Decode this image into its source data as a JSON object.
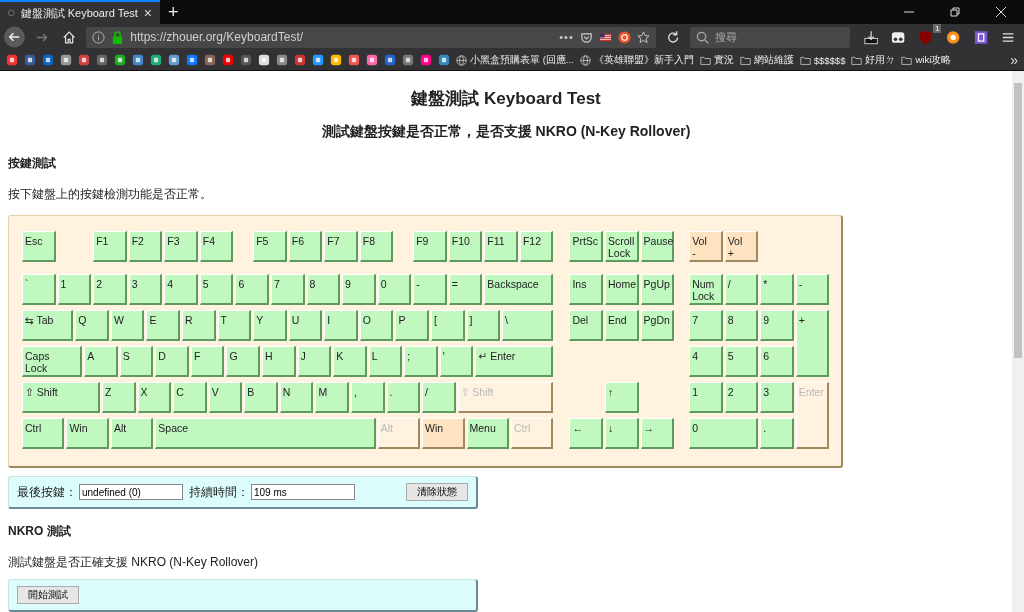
{
  "browser": {
    "tab": {
      "title": "鍵盤測試 Keyboard Test",
      "close": "×"
    },
    "new_tab": "+",
    "url": "https://zhouer.org/KeyboardTest/",
    "page_actions": "•••",
    "search": {
      "placeholder": "搜尋"
    },
    "extension_badge": "1",
    "bookmarks": [
      {
        "kind": "site",
        "label": "小黑盒預購表單 (回應..."
      },
      {
        "kind": "site",
        "label": "《英雄聯盟》新手入門"
      },
      {
        "kind": "folder",
        "label": "實況"
      },
      {
        "kind": "folder",
        "label": "網站維護"
      },
      {
        "kind": "folder",
        "label": "$$$$$$"
      },
      {
        "kind": "folder",
        "label": "好用ㄉ"
      },
      {
        "kind": "folder",
        "label": "wiki攻略"
      }
    ],
    "overflow": "»"
  },
  "page": {
    "title": "鍵盤測試 Keyboard Test",
    "subtitle": "測試鍵盤按鍵是否正常，是否支援 NKRO (N-Key Rollover)",
    "key_test": {
      "heading": "按鍵測試",
      "description": "按下鍵盤上的按鍵檢測功能是否正常。",
      "keyboard": {
        "main_rows": [
          [
            {
              "label": "Esc",
              "tested": true,
              "pressed": false
            },
            {
              "label": "F1",
              "tested": true,
              "pressed": false
            },
            {
              "label": "F2",
              "tested": true,
              "pressed": false
            },
            {
              "label": "F3",
              "tested": true,
              "pressed": false
            },
            {
              "label": "F4",
              "tested": true,
              "pressed": false
            },
            {
              "label": "F5",
              "tested": true,
              "pressed": false
            },
            {
              "label": "F6",
              "tested": true,
              "pressed": false
            },
            {
              "label": "F7",
              "tested": true,
              "pressed": false
            },
            {
              "label": "F8",
              "tested": true,
              "pressed": false
            },
            {
              "label": "F9",
              "tested": true,
              "pressed": false
            },
            {
              "label": "F10",
              "tested": true,
              "pressed": false
            },
            {
              "label": "F11",
              "tested": true,
              "pressed": false
            },
            {
              "label": "F12",
              "tested": true,
              "pressed": false
            }
          ],
          [
            {
              "label": "`",
              "tested": true,
              "pressed": false
            },
            {
              "label": "1",
              "tested": true,
              "pressed": false
            },
            {
              "label": "2",
              "tested": true,
              "pressed": false
            },
            {
              "label": "3",
              "tested": true,
              "pressed": false
            },
            {
              "label": "4",
              "tested": true,
              "pressed": false
            },
            {
              "label": "5",
              "tested": true,
              "pressed": false
            },
            {
              "label": "6",
              "tested": true,
              "pressed": false
            },
            {
              "label": "7",
              "tested": true,
              "pressed": false
            },
            {
              "label": "8",
              "tested": true,
              "pressed": false
            },
            {
              "label": "9",
              "tested": true,
              "pressed": false
            },
            {
              "label": "0",
              "tested": true,
              "pressed": false
            },
            {
              "label": "-",
              "tested": true,
              "pressed": false
            },
            {
              "label": "=",
              "tested": true,
              "pressed": false
            },
            {
              "label": "Backspace",
              "tested": true,
              "pressed": false
            }
          ],
          [
            {
              "label": "⇆ Tab",
              "tested": true,
              "pressed": false
            },
            {
              "label": "Q",
              "tested": true,
              "pressed": false
            },
            {
              "label": "W",
              "tested": true,
              "pressed": false
            },
            {
              "label": "E",
              "tested": true,
              "pressed": false
            },
            {
              "label": "R",
              "tested": true,
              "pressed": false
            },
            {
              "label": "T",
              "tested": true,
              "pressed": false
            },
            {
              "label": "Y",
              "tested": true,
              "pressed": false
            },
            {
              "label": "U",
              "tested": true,
              "pressed": false
            },
            {
              "label": "I",
              "tested": true,
              "pressed": false
            },
            {
              "label": "O",
              "tested": true,
              "pressed": false
            },
            {
              "label": "P",
              "tested": true,
              "pressed": false
            },
            {
              "label": "[",
              "tested": true,
              "pressed": false
            },
            {
              "label": "]",
              "tested": true,
              "pressed": false
            },
            {
              "label": "\\",
              "tested": true,
              "pressed": false
            }
          ],
          [
            {
              "label": "Caps\nLock",
              "tested": true,
              "pressed": false
            },
            {
              "label": "A",
              "tested": true,
              "pressed": false
            },
            {
              "label": "S",
              "tested": true,
              "pressed": false
            },
            {
              "label": "D",
              "tested": true,
              "pressed": false
            },
            {
              "label": "F",
              "tested": true,
              "pressed": false
            },
            {
              "label": "G",
              "tested": true,
              "pressed": false
            },
            {
              "label": "H",
              "tested": true,
              "pressed": false
            },
            {
              "label": "J",
              "tested": true,
              "pressed": false
            },
            {
              "label": "K",
              "tested": true,
              "pressed": false
            },
            {
              "label": "L",
              "tested": true,
              "pressed": false
            },
            {
              "label": ";",
              "tested": true,
              "pressed": false
            },
            {
              "label": "'",
              "tested": true,
              "pressed": false
            },
            {
              "label": "↵ Enter",
              "tested": true,
              "pressed": false
            }
          ],
          [
            {
              "label": "⇧ Shift",
              "tested": true,
              "pressed": false
            },
            {
              "label": "Z",
              "tested": true,
              "pressed": false
            },
            {
              "label": "X",
              "tested": true,
              "pressed": false
            },
            {
              "label": "C",
              "tested": true,
              "pressed": false
            },
            {
              "label": "V",
              "tested": true,
              "pressed": false
            },
            {
              "label": "B",
              "tested": true,
              "pressed": false
            },
            {
              "label": "N",
              "tested": true,
              "pressed": false
            },
            {
              "label": "M",
              "tested": true,
              "pressed": false
            },
            {
              "label": ",",
              "tested": true,
              "pressed": false
            },
            {
              "label": ".",
              "tested": true,
              "pressed": false
            },
            {
              "label": "/",
              "tested": true,
              "pressed": false
            },
            {
              "label": "⇧ Shift",
              "tested": false,
              "pressed": false
            }
          ],
          [
            {
              "label": "Ctrl",
              "tested": true,
              "pressed": false
            },
            {
              "label": "Win",
              "tested": true,
              "pressed": false
            },
            {
              "label": "Alt",
              "tested": true,
              "pressed": false
            },
            {
              "label": "Space",
              "tested": true,
              "pressed": false
            },
            {
              "label": "Alt",
              "tested": false,
              "pressed": false
            },
            {
              "label": "Win",
              "tested": false,
              "pressed": true
            },
            {
              "label": "Menu",
              "tested": true,
              "pressed": false
            },
            {
              "label": "Ctrl",
              "tested": false,
              "pressed": false
            }
          ]
        ],
        "nav_keys": [
          {
            "label": "PrtSc",
            "tested": true,
            "pressed": false
          },
          {
            "label": "Scroll\nLock",
            "tested": true,
            "pressed": false
          },
          {
            "label": "Pause",
            "tested": true,
            "pressed": false
          },
          {
            "label": "Ins",
            "tested": true,
            "pressed": false
          },
          {
            "label": "Home",
            "tested": true,
            "pressed": false
          },
          {
            "label": "PgUp",
            "tested": true,
            "pressed": false
          },
          {
            "label": "Del",
            "tested": true,
            "pressed": false
          },
          {
            "label": "End",
            "tested": true,
            "pressed": false
          },
          {
            "label": "PgDn",
            "tested": true,
            "pressed": false
          },
          {
            "label": "↑",
            "tested": true,
            "pressed": false
          },
          {
            "label": "←",
            "tested": true,
            "pressed": false
          },
          {
            "label": "↓",
            "tested": true,
            "pressed": false
          },
          {
            "label": "→",
            "tested": true,
            "pressed": false
          }
        ],
        "numpad_keys": [
          {
            "label": "Vol\n-",
            "tested": false,
            "pressed": true
          },
          {
            "label": "Vol\n+",
            "tested": false,
            "pressed": true
          },
          {
            "label": "Num\nLock",
            "tested": true,
            "pressed": false
          },
          {
            "label": "/",
            "tested": true,
            "pressed": false
          },
          {
            "label": "*",
            "tested": true,
            "pressed": false
          },
          {
            "label": "-",
            "tested": true,
            "pressed": false
          },
          {
            "label": "7",
            "tested": true,
            "pressed": false
          },
          {
            "label": "8",
            "tested": true,
            "pressed": false
          },
          {
            "label": "9",
            "tested": true,
            "pressed": false
          },
          {
            "label": "+",
            "tested": true,
            "pressed": false
          },
          {
            "label": "4",
            "tested": true,
            "pressed": false
          },
          {
            "label": "5",
            "tested": true,
            "pressed": false
          },
          {
            "label": "6",
            "tested": true,
            "pressed": false
          },
          {
            "label": "1",
            "tested": true,
            "pressed": false
          },
          {
            "label": "2",
            "tested": true,
            "pressed": false
          },
          {
            "label": "3",
            "tested": true,
            "pressed": false
          },
          {
            "label": "Enter",
            "tested": false,
            "pressed": false
          },
          {
            "label": "0",
            "tested": true,
            "pressed": false
          },
          {
            "label": ".",
            "tested": true,
            "pressed": false
          }
        ]
      },
      "status": {
        "last_key_label": "最後按鍵：",
        "last_key": "undefined (0)",
        "duration_label": "持續時間：",
        "duration": "109 ms",
        "clear_button": "清除狀態"
      }
    },
    "nkro_test": {
      "heading": "NKRO 測試",
      "description": "測試鍵盤是否正確支援 NKRO (N-Key Rollover)",
      "start_button": "開始測試"
    }
  }
}
